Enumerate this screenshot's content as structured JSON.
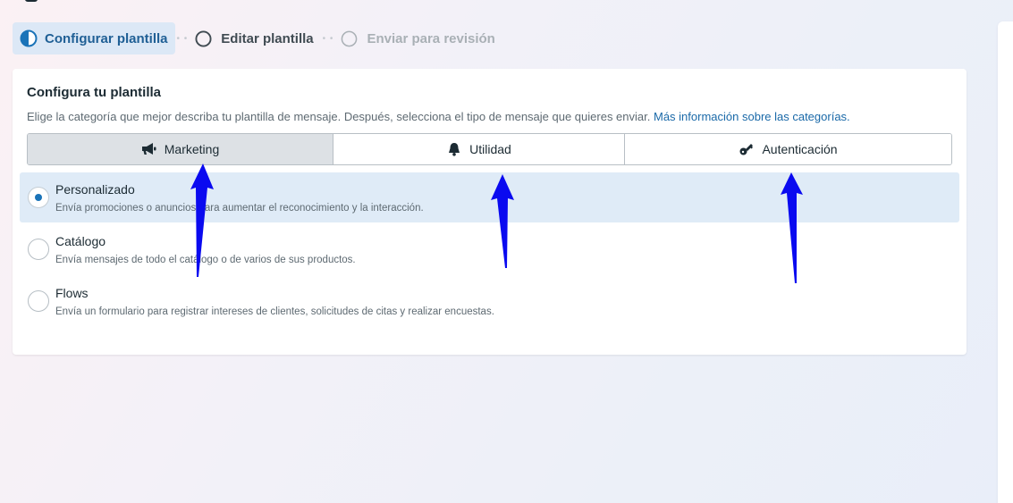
{
  "stepper": {
    "steps": [
      {
        "label": "Configurar plantilla",
        "state": "active",
        "icon": "half-circle-icon"
      },
      {
        "label": "Editar plantilla",
        "state": "default",
        "icon": "circle-outline-icon"
      },
      {
        "label": "Enviar para revisión",
        "state": "disabled",
        "icon": "circle-outline-icon"
      }
    ]
  },
  "card": {
    "title": "Configura tu plantilla",
    "description": "Elige la categoría que mejor describa tu plantilla de mensaje. Después, selecciona el tipo de mensaje que quieres enviar.",
    "link": "Más información sobre las categorías."
  },
  "tabs": [
    {
      "label": "Marketing",
      "icon": "megaphone-icon",
      "selected": true
    },
    {
      "label": "Utilidad",
      "icon": "bell-icon",
      "selected": false
    },
    {
      "label": "Autenticación",
      "icon": "key-icon",
      "selected": false
    }
  ],
  "options": [
    {
      "title": "Personalizado",
      "description": "Envía promociones o anuncios para aumentar el reconocimiento y la interacción.",
      "selected": true
    },
    {
      "title": "Catálogo",
      "description": "Envía mensajes de todo el catálogo o de varios de sus productos.",
      "selected": false
    },
    {
      "title": "Flows",
      "description": "Envía un formulario para registrar intereses de clientes, solicitudes de citas y realizar encuestas.",
      "selected": false
    }
  ],
  "colors": {
    "accent": "#1a73b8",
    "link": "#1a69a8",
    "active_step_bg": "#dce8f6",
    "selected_option_bg": "#dfebf7",
    "annotation_arrow": "#0a0af0"
  }
}
